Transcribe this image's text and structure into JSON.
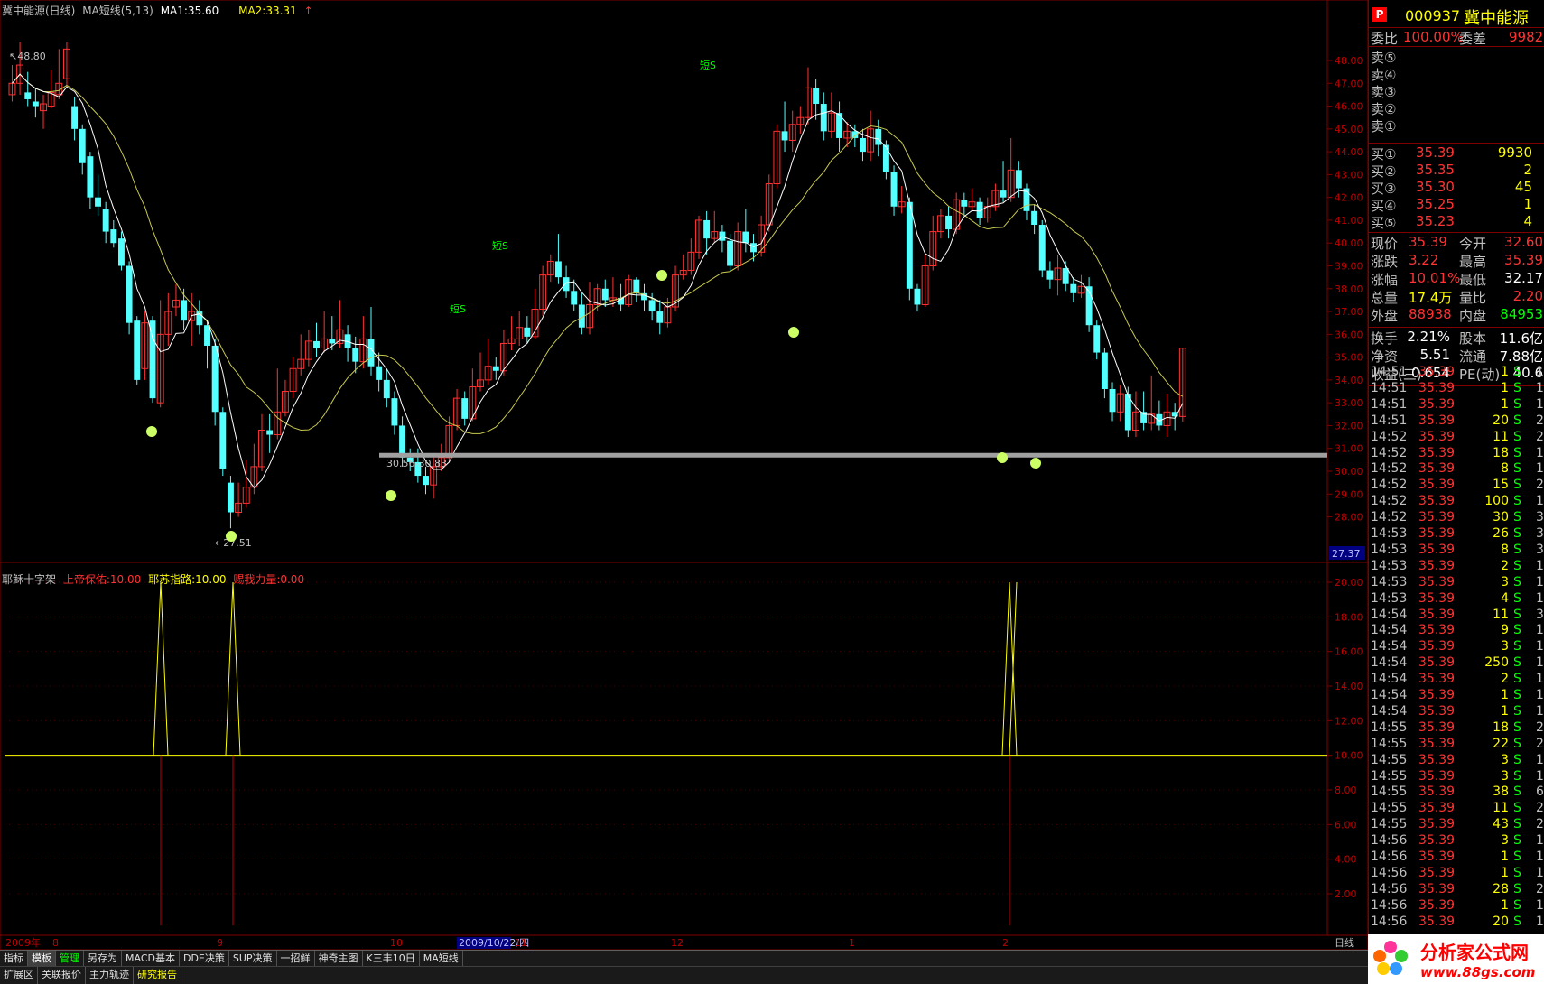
{
  "header": {
    "title": "冀中能源(日线)",
    "ma_label": "MA短线(5,13)",
    "ma1": "MA1:35.60",
    "ma2": "MA2:33.31",
    "arrow": "↑"
  },
  "sub_header": {
    "title": "耶稣十字架",
    "item1": "上帝保佑:10.00",
    "item2": "耶苏指路:10.00",
    "item3": "赐我力量:0.00"
  },
  "annotations": {
    "high": "48.80",
    "low": "←27.51",
    "range": "30.56-30.83",
    "buy_label": "短S",
    "crosshair_price": "27.37"
  },
  "price_axis": [
    "48.00",
    "47.00",
    "46.00",
    "45.00",
    "44.00",
    "43.00",
    "42.00",
    "41.00",
    "40.00",
    "39.00",
    "38.00",
    "37.00",
    "36.00",
    "35.00",
    "34.00",
    "33.00",
    "32.00",
    "31.00",
    "30.00",
    "29.00",
    "28.00"
  ],
  "sub_axis": [
    "20.00",
    "18.00",
    "16.00",
    "14.00",
    "12.00",
    "10.00",
    "8.00",
    "6.00",
    "4.00",
    "2.00"
  ],
  "date_axis": {
    "y2009": "2009年",
    "m8": "8",
    "m9": "9",
    "m10": "10",
    "cursor_date": "2009/10/22/四",
    "m11": "11",
    "m12": "12",
    "m1": "1",
    "m2": "2",
    "period": "日线"
  },
  "toolbar1": [
    "指标",
    "模板",
    "管理",
    "另存为",
    "MACD基本",
    "DDE决策",
    "SUP决策",
    "一招鲜",
    "神奇主图",
    "K三丰10日",
    "MA短线"
  ],
  "toolbar2": [
    "扩展区",
    "关联报价",
    "主力轨迹",
    "研究报告"
  ],
  "quote": {
    "code": "000937",
    "name": "冀中能源",
    "weibi_label": "委比",
    "weibi": "100.00%",
    "weicha_label": "委差",
    "weicha": "9982",
    "sells": [
      "卖⑤",
      "卖④",
      "卖③",
      "卖②",
      "卖①"
    ],
    "buys": [
      {
        "label": "买①",
        "price": "35.39",
        "vol": "9930"
      },
      {
        "label": "买②",
        "price": "35.35",
        "vol": "2"
      },
      {
        "label": "买③",
        "price": "35.30",
        "vol": "45"
      },
      {
        "label": "买④",
        "price": "35.25",
        "vol": "1"
      },
      {
        "label": "买⑤",
        "price": "35.23",
        "vol": "4"
      }
    ],
    "stats": [
      {
        "l1": "现价",
        "v1": "35.39",
        "l2": "今开",
        "v2": "32.60"
      },
      {
        "l1": "涨跌",
        "v1": "3.22",
        "l2": "最高",
        "v2": "35.39"
      },
      {
        "l1": "涨幅",
        "v1": "10.01%",
        "l2": "最低",
        "v2": "32.17"
      },
      {
        "l1": "总量",
        "v1": "17.4万",
        "l2": "量比",
        "v2": "2.20"
      },
      {
        "l1": "外盘",
        "v1": "88938",
        "l2": "内盘",
        "v2": "84953"
      }
    ],
    "fin": [
      {
        "l1": "换手",
        "v1": "2.21%",
        "l2": "股本",
        "v2": "11.6亿"
      },
      {
        "l1": "净资",
        "v1": "5.51",
        "l2": "流通",
        "v2": "7.88亿"
      },
      {
        "l1": "收益(三)",
        "v1": "0.654",
        "l2": "PE(动)",
        "v2": "40.6"
      }
    ]
  },
  "ticks": [
    [
      "14:51",
      "35.39",
      "1",
      "S",
      "1"
    ],
    [
      "14:51",
      "35.39",
      "1",
      "S",
      "1"
    ],
    [
      "14:51",
      "35.39",
      "1",
      "S",
      "1"
    ],
    [
      "14:51",
      "35.39",
      "20",
      "S",
      "2"
    ],
    [
      "14:52",
      "35.39",
      "11",
      "S",
      "2"
    ],
    [
      "14:52",
      "35.39",
      "18",
      "S",
      "1"
    ],
    [
      "14:52",
      "35.39",
      "8",
      "S",
      "1"
    ],
    [
      "14:52",
      "35.39",
      "15",
      "S",
      "2"
    ],
    [
      "14:52",
      "35.39",
      "100",
      "S",
      "1"
    ],
    [
      "14:52",
      "35.39",
      "30",
      "S",
      "3"
    ],
    [
      "14:53",
      "35.39",
      "26",
      "S",
      "3"
    ],
    [
      "14:53",
      "35.39",
      "8",
      "S",
      "3"
    ],
    [
      "14:53",
      "35.39",
      "2",
      "S",
      "1"
    ],
    [
      "14:53",
      "35.39",
      "3",
      "S",
      "1"
    ],
    [
      "14:53",
      "35.39",
      "4",
      "S",
      "1"
    ],
    [
      "14:54",
      "35.39",
      "11",
      "S",
      "3"
    ],
    [
      "14:54",
      "35.39",
      "9",
      "S",
      "1"
    ],
    [
      "14:54",
      "35.39",
      "3",
      "S",
      "1"
    ],
    [
      "14:54",
      "35.39",
      "250",
      "S",
      "1"
    ],
    [
      "14:54",
      "35.39",
      "2",
      "S",
      "1"
    ],
    [
      "14:54",
      "35.39",
      "1",
      "S",
      "1"
    ],
    [
      "14:54",
      "35.39",
      "1",
      "S",
      "1"
    ],
    [
      "14:55",
      "35.39",
      "18",
      "S",
      "2"
    ],
    [
      "14:55",
      "35.39",
      "22",
      "S",
      "2"
    ],
    [
      "14:55",
      "35.39",
      "3",
      "S",
      "1"
    ],
    [
      "14:55",
      "35.39",
      "3",
      "S",
      "1"
    ],
    [
      "14:55",
      "35.39",
      "38",
      "S",
      "6"
    ],
    [
      "14:55",
      "35.39",
      "11",
      "S",
      "2"
    ],
    [
      "14:55",
      "35.39",
      "43",
      "S",
      "2"
    ],
    [
      "14:56",
      "35.39",
      "3",
      "S",
      "1"
    ],
    [
      "14:56",
      "35.39",
      "1",
      "S",
      "1"
    ],
    [
      "14:56",
      "35.39",
      "1",
      "S",
      "1"
    ],
    [
      "14:56",
      "35.39",
      "28",
      "S",
      "2"
    ],
    [
      "14:56",
      "35.39",
      "1",
      "S",
      "1"
    ],
    [
      "14:56",
      "35.39",
      "20",
      "S",
      "1"
    ]
  ],
  "logo": {
    "text": "分析家公式网",
    "url": "www.88gs.com"
  },
  "colors": {
    "up": "#ff3232",
    "down": "#54ffff",
    "ma1": "#ffffff",
    "ma2": "#c8c850",
    "grid": "#800000",
    "axis_text": "#c00000"
  }
}
